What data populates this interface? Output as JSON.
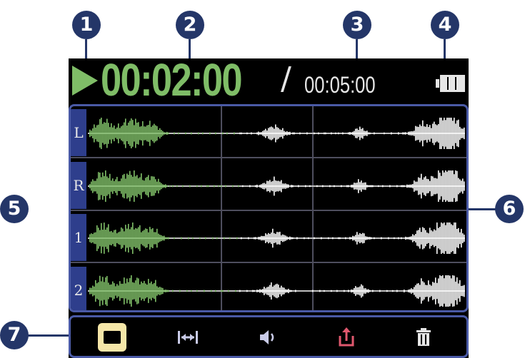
{
  "callouts": {
    "c1": "1",
    "c2": "2",
    "c3": "3",
    "c4": "4",
    "c5": "5",
    "c6": "6",
    "c7": "7"
  },
  "header": {
    "playback_state_icon": "play-icon",
    "current_time": "00:02:00",
    "separator": "/",
    "total_time": "00:05:00",
    "battery_icon": "battery-icon"
  },
  "tracks": [
    {
      "label": "L",
      "color_played": "#7fbd67",
      "color_unplayed": "#ffffff"
    },
    {
      "label": "R",
      "color_played": "#7fbd67",
      "color_unplayed": "#ffffff"
    },
    {
      "label": "1",
      "color_played": "#7fbd67",
      "color_unplayed": "#ffffff"
    },
    {
      "label": "2",
      "color_played": "#7fbd67",
      "color_unplayed": "#ffffff"
    }
  ],
  "playback_position_fraction": 0.4,
  "toolbar": {
    "items": [
      {
        "icon": "folder-icon",
        "selected": true
      },
      {
        "icon": "trim-icon",
        "selected": false
      },
      {
        "icon": "volume-icon",
        "selected": false
      },
      {
        "icon": "export-icon",
        "selected": false
      },
      {
        "icon": "trash-icon",
        "selected": false
      }
    ]
  },
  "colors": {
    "accent": "#7fbd67",
    "callout": "#243668",
    "frame": "#4a5aa6",
    "selected_bg": "#f5e6a8",
    "export_icon": "#e0586e"
  }
}
